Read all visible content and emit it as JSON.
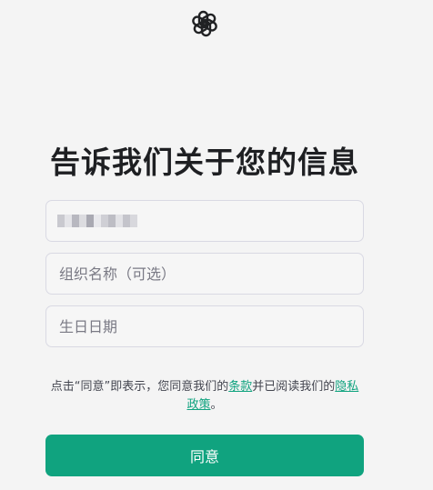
{
  "brand": {
    "logo_icon": "openai-logo-icon",
    "accent": "#10a37f"
  },
  "title": "告诉我们关于您的信息",
  "form": {
    "email": {
      "value": ""
    },
    "organization": {
      "placeholder": "组织名称（可选）"
    },
    "birthday": {
      "placeholder": "生日日期"
    }
  },
  "terms": {
    "prefix": "点击“同意”即表示，您同意我们的",
    "terms_link": "条款",
    "middle": "并已阅读我们的",
    "privacy_link": "隐私政策",
    "suffix": "。"
  },
  "submit": {
    "label": "同意",
    "color": "#10a37f"
  }
}
